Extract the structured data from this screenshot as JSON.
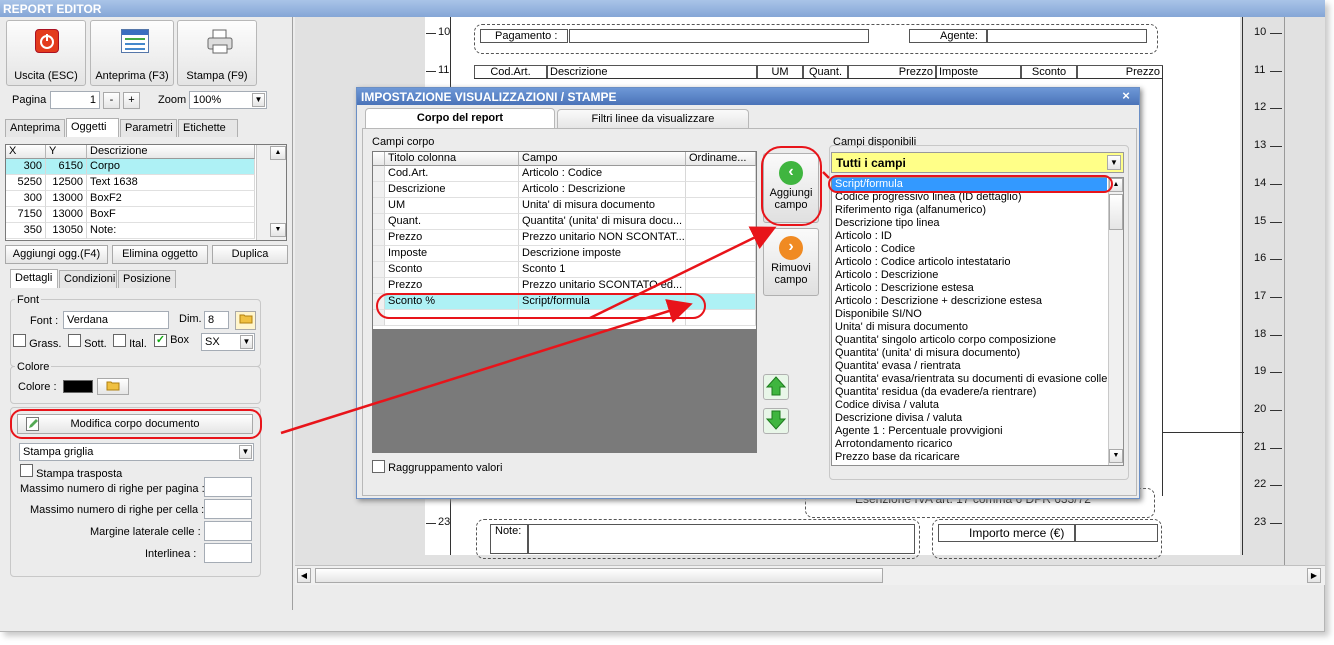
{
  "app": {
    "title": "REPORT EDITOR"
  },
  "toolbar": {
    "exit_label": "Uscita (ESC)",
    "preview_label": "Anteprima (F3)",
    "print_label": "Stampa (F9)"
  },
  "nav": {
    "page_label": "Pagina",
    "page_value": "1",
    "minus": "-",
    "plus": "+",
    "zoom_label": "Zoom",
    "zoom_value": "100%"
  },
  "left_tabs": [
    "Anteprima",
    "Oggetti",
    "Parametri",
    "Etichette"
  ],
  "objects": {
    "headers": [
      "X",
      "Y",
      "Descrizione"
    ],
    "rows": [
      [
        "300",
        "6150",
        "Corpo"
      ],
      [
        "5250",
        "12500",
        "Text 1638"
      ],
      [
        "300",
        "13000",
        "BoxF2"
      ],
      [
        "7150",
        "13000",
        "BoxF"
      ],
      [
        "350",
        "13050",
        "Note:"
      ]
    ]
  },
  "obj_buttons": {
    "add": "Aggiungi ogg.(F4)",
    "delete": "Elimina oggetto",
    "duplicate": "Duplica"
  },
  "detail_tabs": [
    "Dettagli",
    "Condizioni",
    "Posizione"
  ],
  "font": {
    "group": "Font",
    "font_label": "Font :",
    "font_value": "Verdana",
    "dim_label": "Dim.",
    "dim_value": "8",
    "bold": "Grass.",
    "underline": "Sott.",
    "italic": "Ital.",
    "box": "Box",
    "align": "SX"
  },
  "color": {
    "group": "Colore",
    "label": "Colore :",
    "value": "#000000"
  },
  "body_section": {
    "edit_button": "Modifica corpo documento",
    "print_mode": "Stampa griglia",
    "transposed": "Stampa trasposta",
    "max_rows_page": "Massimo numero di righe per pagina :",
    "max_rows_cell": "Massimo numero di righe per cella :",
    "margin": "Margine laterale celle :",
    "line_spacing": "Interlinea :"
  },
  "report": {
    "ruler_left": [
      "10",
      "11",
      "23"
    ],
    "ruler_right": [
      "10",
      "11",
      "12",
      "13",
      "14",
      "15",
      "16",
      "17",
      "18",
      "19",
      "20",
      "21",
      "22",
      "23"
    ],
    "payment": "Pagamento :",
    "agent": "Agente:",
    "columns": [
      "Cod.Art.",
      "Descrizione",
      "UM",
      "Quant.",
      "Prezzo",
      "Imposte",
      "Sconto",
      "Prezzo"
    ],
    "exemption": "Esenzione IVA art. 17 comma 6 DPR 633/72",
    "note": "Note:",
    "goods_amount": "Importo merce (€)"
  },
  "dialog": {
    "title": "IMPOSTAZIONE VISUALIZZAZIONI / STAMPE",
    "close": "×",
    "tabs": [
      "Corpo del report",
      "Filtri linee da visualizzare"
    ],
    "body_group": "Campi corpo",
    "grid_headers": [
      "Titolo colonna",
      "Campo",
      "Ordiname..."
    ],
    "grid_rows": [
      [
        "Cod.Art.",
        "Articolo : Codice"
      ],
      [
        "Descrizione",
        "Articolo : Descrizione"
      ],
      [
        "UM",
        "Unita' di misura documento"
      ],
      [
        "Quant.",
        "Quantita' (unita' di misura docu..."
      ],
      [
        "Prezzo",
        "Prezzo unitario NON SCONTAT..."
      ],
      [
        "Imposte",
        "Descrizione imposte"
      ],
      [
        "Sconto",
        "Sconto 1"
      ],
      [
        "Prezzo",
        "Prezzo unitario SCONTATO ed..."
      ],
      [
        "Sconto %",
        "Script/formula"
      ]
    ],
    "add_field": "Aggiungi campo",
    "remove_field": "Rimuovi campo",
    "grouping": "Raggruppamento valori",
    "available_group": "Campi disponibili",
    "filter_value": "Tutti i campi",
    "available": [
      "Script/formula",
      "Codice progressivo linea (ID dettaglio)",
      "Riferimento riga (alfanumerico)",
      "Descrizione tipo linea",
      "Articolo : ID",
      "Articolo : Codice",
      "Articolo : Codice articolo intestatario",
      "Articolo : Descrizione",
      "Articolo : Descrizione estesa",
      "Articolo : Descrizione + descrizione estesa",
      "Disponibile SI/NO",
      "Unita' di misura documento",
      "Quantita' singolo articolo corpo composizione",
      "Quantita' (unita' di misura documento)",
      "Quantita' evasa / rientrata",
      "Quantita' evasa/rientrata su documenti di evasione colleg",
      "Quantita' residua (da evadere/a rientrare)",
      "Codice divisa / valuta",
      "Descrizione divisa / valuta",
      "Agente 1 : Percentuale provvigioni",
      "Arrotondamento ricarico",
      "Prezzo base da ricaricare"
    ]
  },
  "colors": {
    "highlight": "#aef1f5",
    "selected": "#3399ff",
    "annotation": "#e8141a",
    "filter_bg": "#ffff88"
  }
}
